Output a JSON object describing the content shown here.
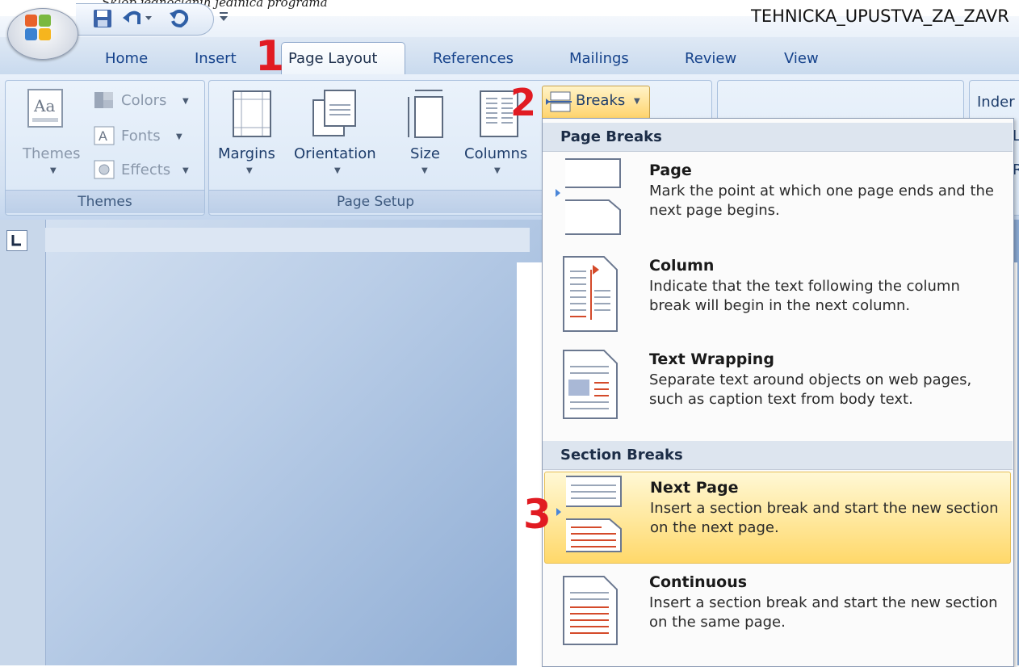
{
  "titlebar": {
    "top_text": "Sklop jednočlanih jedinica programa",
    "document_title": "TEHNICKA_UPUSTVA_ZA_ZAVR"
  },
  "tabs": [
    "Home",
    "Insert",
    "Page Layout",
    "References",
    "Mailings",
    "Review",
    "View"
  ],
  "active_tab": "Page Layout",
  "annotations": [
    "1",
    "2",
    "3"
  ],
  "ribbon": {
    "themes_group": {
      "label": "Themes",
      "themes_button": "Themes",
      "colors": "Colors",
      "fonts": "Fonts",
      "effects": "Effects"
    },
    "page_setup_group": {
      "label": "Page Setup",
      "margins": "Margins",
      "orientation": "Orientation",
      "size": "Size",
      "columns": "Columns",
      "breaks": "Breaks"
    },
    "cut_off_text": [
      "Inder",
      "L",
      "R"
    ]
  },
  "breaks_menu": {
    "page_breaks_header": "Page Breaks",
    "section_breaks_header": "Section Breaks",
    "items": [
      {
        "title": "Page",
        "description": "Mark the point at which one page ends and the next page begins."
      },
      {
        "title": "Column",
        "description": "Indicate that the text following the column break will begin in the next column."
      },
      {
        "title": "Text Wrapping",
        "description": "Separate text around objects on web pages, such as caption text from body text."
      },
      {
        "title": "Next Page",
        "description": "Insert a section break and start the new section on the next page.",
        "highlighted": true
      },
      {
        "title": "Continuous",
        "description": "Insert a section break and start the new section on the same page."
      }
    ]
  },
  "colors": {
    "annotation_red": "#e11b22",
    "menu_highlight": "#ffd86a",
    "tab_text": "#15428b"
  }
}
